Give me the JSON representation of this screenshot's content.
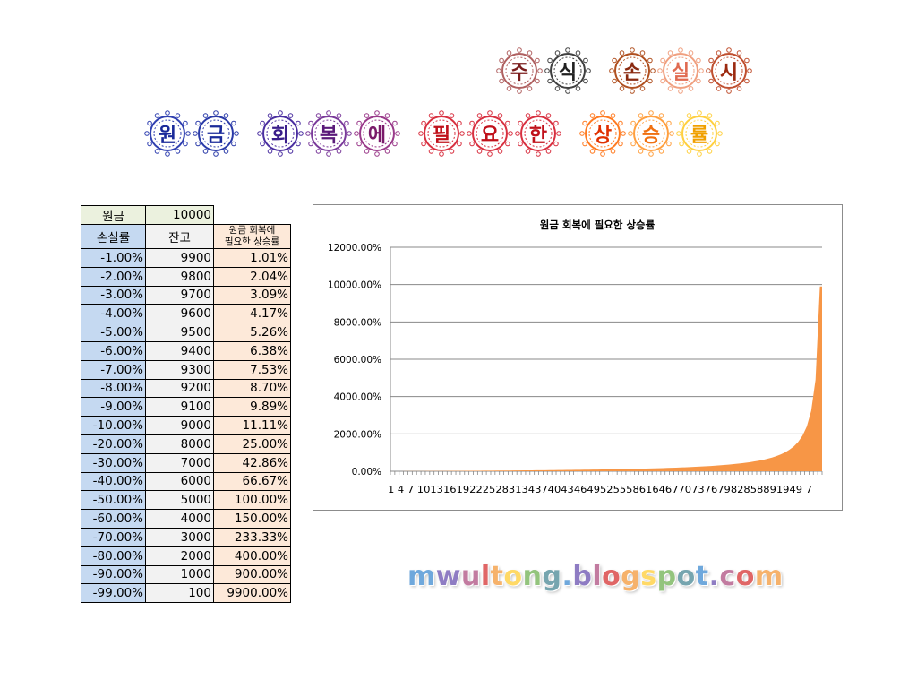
{
  "title": {
    "line1": [
      {
        "ch": "주",
        "color": "#7a1c1c",
        "ring": "#b06060"
      },
      {
        "ch": "식",
        "color": "#202020",
        "ring": "#404040"
      },
      {
        "ch": "손",
        "color": "#8a2a10",
        "ring": "#b05020"
      },
      {
        "ch": "실",
        "color": "#e06a50",
        "ring": "#f0a080"
      },
      {
        "ch": "시",
        "color": "#9c2a10",
        "ring": "#c05030"
      }
    ],
    "line2": [
      {
        "ch": "원",
        "color": "#1a2a9a",
        "ring": "#3040b0"
      },
      {
        "ch": "금",
        "color": "#1a2a9a",
        "ring": "#2a3aa8"
      },
      {
        "ch": "회",
        "color": "#3a1e8a",
        "ring": "#4a2ea0"
      },
      {
        "ch": "복",
        "color": "#5a1a7a",
        "ring": "#7a3a9a"
      },
      {
        "ch": "에",
        "color": "#7a1a6a",
        "ring": "#9a3a8a"
      },
      {
        "ch": "필",
        "color": "#c0101a",
        "ring": "#d83040"
      },
      {
        "ch": "요",
        "color": "#c0101a",
        "ring": "#d83040"
      },
      {
        "ch": "한",
        "color": "#c0101a",
        "ring": "#d83040"
      },
      {
        "ch": "상",
        "color": "#e03000",
        "ring": "#ff7a20"
      },
      {
        "ch": "승",
        "color": "#f07010",
        "ring": "#ffa040"
      },
      {
        "ch": "률",
        "color": "#f0a000",
        "ring": "#ffd040"
      }
    ]
  },
  "table": {
    "principal_label": "원금",
    "principal_value": "10000",
    "headers": [
      "손실률",
      "잔고",
      "원금 회복에",
      "필요한 상승률"
    ],
    "rows": [
      [
        "-1.00%",
        "9900",
        "1.01%"
      ],
      [
        "-2.00%",
        "9800",
        "2.04%"
      ],
      [
        "-3.00%",
        "9700",
        "3.09%"
      ],
      [
        "-4.00%",
        "9600",
        "4.17%"
      ],
      [
        "-5.00%",
        "9500",
        "5.26%"
      ],
      [
        "-6.00%",
        "9400",
        "6.38%"
      ],
      [
        "-7.00%",
        "9300",
        "7.53%"
      ],
      [
        "-8.00%",
        "9200",
        "8.70%"
      ],
      [
        "-9.00%",
        "9100",
        "9.89%"
      ],
      [
        "-10.00%",
        "9000",
        "11.11%"
      ],
      [
        "-20.00%",
        "8000",
        "25.00%"
      ],
      [
        "-30.00%",
        "7000",
        "42.86%"
      ],
      [
        "-40.00%",
        "6000",
        "66.67%"
      ],
      [
        "-50.00%",
        "5000",
        "100.00%"
      ],
      [
        "-60.00%",
        "4000",
        "150.00%"
      ],
      [
        "-70.00%",
        "3000",
        "233.33%"
      ],
      [
        "-80.00%",
        "2000",
        "400.00%"
      ],
      [
        "-90.00%",
        "1000",
        "900.00%"
      ],
      [
        "-99.00%",
        "100",
        "9900.00%"
      ]
    ]
  },
  "chart_data": {
    "type": "area",
    "title": "원금 회복에 필요한 상승률",
    "xlabel": "",
    "ylabel": "",
    "ylim": [
      0,
      12000
    ],
    "y_ticks": [
      "0.00%",
      "2000.00%",
      "4000.00%",
      "6000.00%",
      "8000.00%",
      "10000.00%",
      "12000.00%"
    ],
    "x_tick_text": "1 4 7 10131619222528313437404346495255586164677073767982858891949 7",
    "x_tick_labels": [
      "1",
      "4",
      "7",
      "10",
      "13",
      "16",
      "19",
      "22",
      "25",
      "28",
      "31",
      "34",
      "37",
      "40",
      "43",
      "46",
      "49",
      "52",
      "55",
      "58",
      "61",
      "64",
      "67",
      "70",
      "73",
      "76",
      "79",
      "82",
      "85",
      "88",
      "91",
      "94",
      "97"
    ],
    "x_range": [
      1,
      99
    ],
    "series": [
      {
        "color": "#f79646",
        "description": "y = 100*x/(100-x) percent for x = 1..99 (loss %)"
      }
    ],
    "grid": true,
    "legend": "none"
  },
  "blog": {
    "text": "mwultong.blogspot.com",
    "colors": [
      "#6fa8dc",
      "#8e7cc3",
      "#c27ba0",
      "#e06666",
      "#f6b26b",
      "#ffd966",
      "#93c47d",
      "#76a5af"
    ]
  }
}
